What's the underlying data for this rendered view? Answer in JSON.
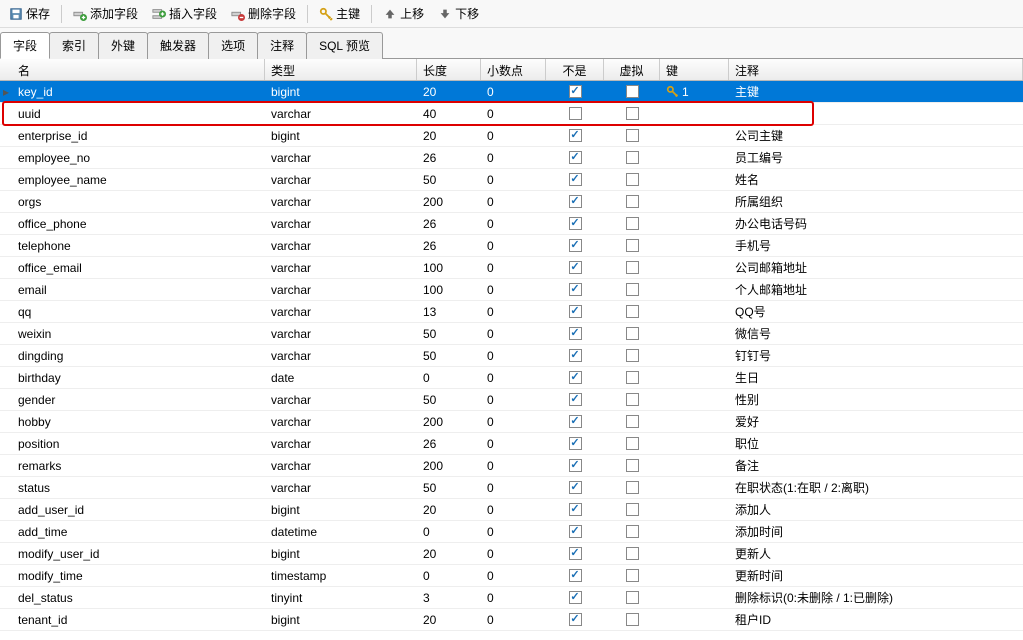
{
  "toolbar": {
    "save": "保存",
    "add_field": "添加字段",
    "insert_field": "插入字段",
    "delete_field": "删除字段",
    "primary_key": "主键",
    "move_up": "上移",
    "move_down": "下移"
  },
  "tabs": [
    "字段",
    "索引",
    "外键",
    "触发器",
    "选项",
    "注释",
    "SQL 预览"
  ],
  "active_tab": 0,
  "columns": {
    "name": "名",
    "type": "类型",
    "length": "长度",
    "decimals": "小数点",
    "not_null": "不是 null",
    "virtual": "虚拟",
    "key": "键",
    "comment": "注释"
  },
  "rows": [
    {
      "name": "key_id",
      "type": "bigint",
      "length": "20",
      "decimals": "0",
      "not_null": true,
      "virtual": false,
      "key": "1",
      "comment": "主键",
      "selected": true,
      "marker": true
    },
    {
      "name": "uuid",
      "type": "varchar",
      "length": "40",
      "decimals": "0",
      "not_null": false,
      "virtual": false,
      "key": "",
      "comment": "",
      "highlight": true
    },
    {
      "name": "enterprise_id",
      "type": "bigint",
      "length": "20",
      "decimals": "0",
      "not_null": true,
      "virtual": false,
      "key": "",
      "comment": "公司主键"
    },
    {
      "name": "employee_no",
      "type": "varchar",
      "length": "26",
      "decimals": "0",
      "not_null": true,
      "virtual": false,
      "key": "",
      "comment": "员工编号"
    },
    {
      "name": "employee_name",
      "type": "varchar",
      "length": "50",
      "decimals": "0",
      "not_null": true,
      "virtual": false,
      "key": "",
      "comment": "姓名"
    },
    {
      "name": "orgs",
      "type": "varchar",
      "length": "200",
      "decimals": "0",
      "not_null": true,
      "virtual": false,
      "key": "",
      "comment": "所属组织"
    },
    {
      "name": "office_phone",
      "type": "varchar",
      "length": "26",
      "decimals": "0",
      "not_null": true,
      "virtual": false,
      "key": "",
      "comment": "办公电话号码"
    },
    {
      "name": "telephone",
      "type": "varchar",
      "length": "26",
      "decimals": "0",
      "not_null": true,
      "virtual": false,
      "key": "",
      "comment": "手机号"
    },
    {
      "name": "office_email",
      "type": "varchar",
      "length": "100",
      "decimals": "0",
      "not_null": true,
      "virtual": false,
      "key": "",
      "comment": "公司邮箱地址"
    },
    {
      "name": "email",
      "type": "varchar",
      "length": "100",
      "decimals": "0",
      "not_null": true,
      "virtual": false,
      "key": "",
      "comment": "个人邮箱地址"
    },
    {
      "name": "qq",
      "type": "varchar",
      "length": "13",
      "decimals": "0",
      "not_null": true,
      "virtual": false,
      "key": "",
      "comment": "QQ号"
    },
    {
      "name": "weixin",
      "type": "varchar",
      "length": "50",
      "decimals": "0",
      "not_null": true,
      "virtual": false,
      "key": "",
      "comment": "微信号"
    },
    {
      "name": "dingding",
      "type": "varchar",
      "length": "50",
      "decimals": "0",
      "not_null": true,
      "virtual": false,
      "key": "",
      "comment": "钉钉号"
    },
    {
      "name": "birthday",
      "type": "date",
      "length": "0",
      "decimals": "0",
      "not_null": true,
      "virtual": false,
      "key": "",
      "comment": "生日"
    },
    {
      "name": "gender",
      "type": "varchar",
      "length": "50",
      "decimals": "0",
      "not_null": true,
      "virtual": false,
      "key": "",
      "comment": "性别"
    },
    {
      "name": "hobby",
      "type": "varchar",
      "length": "200",
      "decimals": "0",
      "not_null": true,
      "virtual": false,
      "key": "",
      "comment": "爱好"
    },
    {
      "name": "position",
      "type": "varchar",
      "length": "26",
      "decimals": "0",
      "not_null": true,
      "virtual": false,
      "key": "",
      "comment": "职位"
    },
    {
      "name": "remarks",
      "type": "varchar",
      "length": "200",
      "decimals": "0",
      "not_null": true,
      "virtual": false,
      "key": "",
      "comment": "备注"
    },
    {
      "name": "status",
      "type": "varchar",
      "length": "50",
      "decimals": "0",
      "not_null": true,
      "virtual": false,
      "key": "",
      "comment": "在职状态(1:在职 / 2:离职)"
    },
    {
      "name": "add_user_id",
      "type": "bigint",
      "length": "20",
      "decimals": "0",
      "not_null": true,
      "virtual": false,
      "key": "",
      "comment": "添加人"
    },
    {
      "name": "add_time",
      "type": "datetime",
      "length": "0",
      "decimals": "0",
      "not_null": true,
      "virtual": false,
      "key": "",
      "comment": "添加时间"
    },
    {
      "name": "modify_user_id",
      "type": "bigint",
      "length": "20",
      "decimals": "0",
      "not_null": true,
      "virtual": false,
      "key": "",
      "comment": "更新人"
    },
    {
      "name": "modify_time",
      "type": "timestamp",
      "length": "0",
      "decimals": "0",
      "not_null": true,
      "virtual": false,
      "key": "",
      "comment": "更新时间"
    },
    {
      "name": "del_status",
      "type": "tinyint",
      "length": "3",
      "decimals": "0",
      "not_null": true,
      "virtual": false,
      "key": "",
      "comment": "删除标识(0:未删除 / 1:已删除)"
    },
    {
      "name": "tenant_id",
      "type": "bigint",
      "length": "20",
      "decimals": "0",
      "not_null": true,
      "virtual": false,
      "key": "",
      "comment": "租户ID"
    }
  ]
}
